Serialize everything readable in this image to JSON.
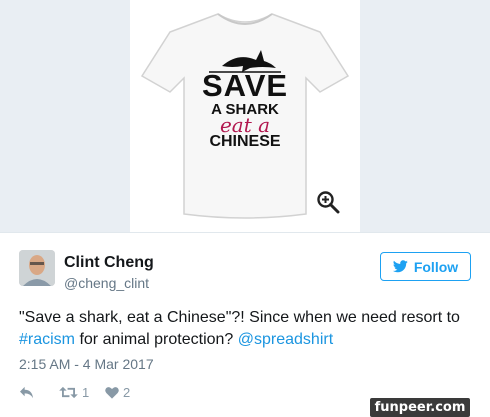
{
  "product_image": {
    "shirt_lines": [
      "SAVE",
      "A SHARK",
      "eat a",
      "CHINESE"
    ],
    "shirt_accent_color": "#b2184f",
    "zoom_icon": "zoom-in-icon"
  },
  "tweet": {
    "author_name": "Clint Cheng",
    "author_handle": "@cheng_clint",
    "follow_label": "Follow",
    "text_part1": "\"Save a shark, eat a Chinese\"?! Since when we need resort to",
    "hashtag": "#racism",
    "text_part2": " for animal protection? ",
    "mention": "@spreadshirt",
    "timestamp": "2:15 AM - 4 Mar 2017",
    "retweet_count": "1",
    "like_count": "2"
  },
  "colors": {
    "accent": "#1da1f2",
    "link": "#1b95e0",
    "muted": "#657786"
  },
  "watermark": "funpeer.com"
}
